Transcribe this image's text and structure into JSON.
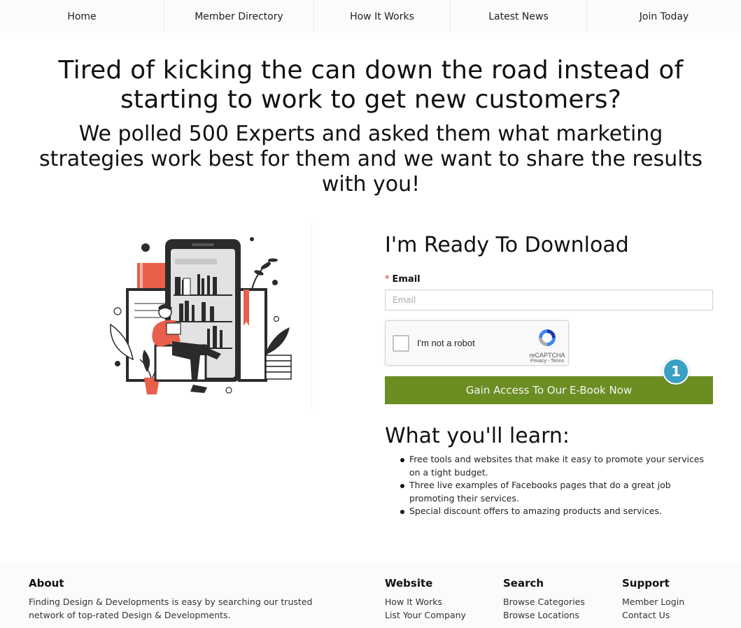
{
  "nav": {
    "items": [
      "Home",
      "Member Directory",
      "How It Works",
      "Latest News",
      "Join Today"
    ]
  },
  "hero": {
    "title": "Tired of kicking the can down the road instead of starting to work to get new customers?",
    "subtitle": "We polled 500 Experts and asked them what marketing strategies work best for them and we want to share the results with you!"
  },
  "illustration": {
    "icon": "person-reading-on-phone-illustration",
    "colors": {
      "accent": "#e8604c",
      "dark": "#2b2b2b",
      "light": "#e2e2e2"
    }
  },
  "form": {
    "title": "I'm Ready To Download",
    "email_label": "Email",
    "required_mark": "*",
    "email_placeholder": "Email",
    "email_value": "",
    "captcha_text": "I'm not a robot",
    "captcha_brand": "reCAPTCHA",
    "captcha_links": "Privacy - Terms",
    "submit_label": "Gain Access To Our E-Book Now",
    "badge_number": "1",
    "colors": {
      "button": "#6b8e23",
      "badge": "#3aa0c4"
    }
  },
  "learn": {
    "title": "What you'll learn:",
    "items": [
      "Free tools and websites that make it easy to promote your services on a tight budget.",
      "Three live examples of Facebooks pages that do a great job promoting their services.",
      "Special discount offers to amazing products and services."
    ]
  },
  "footer": {
    "about": {
      "heading": "About",
      "text": "Finding Design & Developments is easy by searching our trusted network of top-rated Design & Developments."
    },
    "website": {
      "heading": "Website",
      "links": [
        "How It Works",
        "List Your Company"
      ]
    },
    "search": {
      "heading": "Search",
      "links": [
        "Browse Categories",
        "Browse Locations"
      ]
    },
    "support": {
      "heading": "Support",
      "links": [
        "Member Login",
        "Contact Us"
      ]
    }
  }
}
